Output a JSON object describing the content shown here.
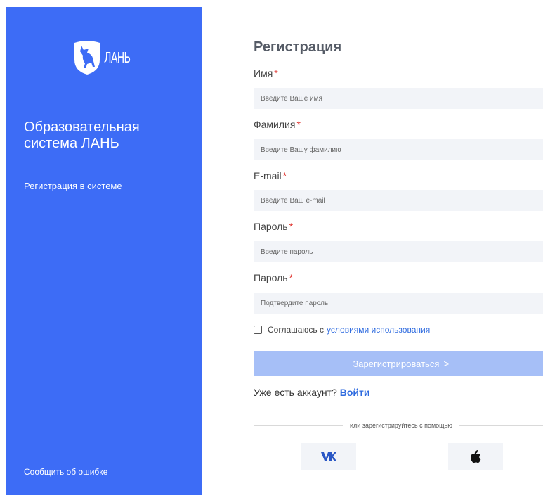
{
  "brand": {
    "logo_text": "ЛАНЬ",
    "system_title": "Образовательная система ЛАНЬ",
    "subtitle": "Регистрация в системе",
    "report_link": "Сообщить об ошибке",
    "color": "#3d6cf6"
  },
  "form": {
    "title": "Регистрация",
    "required_mark": "*",
    "fields": [
      {
        "label": "Имя",
        "placeholder": "Введите Ваше имя"
      },
      {
        "label": "Фамилия",
        "placeholder": "Введите Вашу фамилию"
      },
      {
        "label": "E-mail",
        "placeholder": "Введите Ваш e-mail"
      },
      {
        "label": "Пароль",
        "placeholder": "Введите пароль"
      },
      {
        "label": "Пароль",
        "placeholder": "Подтвердите пароль"
      }
    ],
    "agree_text": "Соглашаюсь с",
    "terms_link": "условиями использования",
    "submit_label": "Зарегистрироваться",
    "submit_icon": ">",
    "have_account": "Уже есть аккаунт?",
    "login_link": "Войти",
    "social_divider": "или зарегистрируйтесь с помощью",
    "social": [
      {
        "name": "vk",
        "icon": "vk-icon",
        "glyph": "ʬ"
      },
      {
        "name": "apple",
        "icon": "apple-icon"
      }
    ]
  }
}
